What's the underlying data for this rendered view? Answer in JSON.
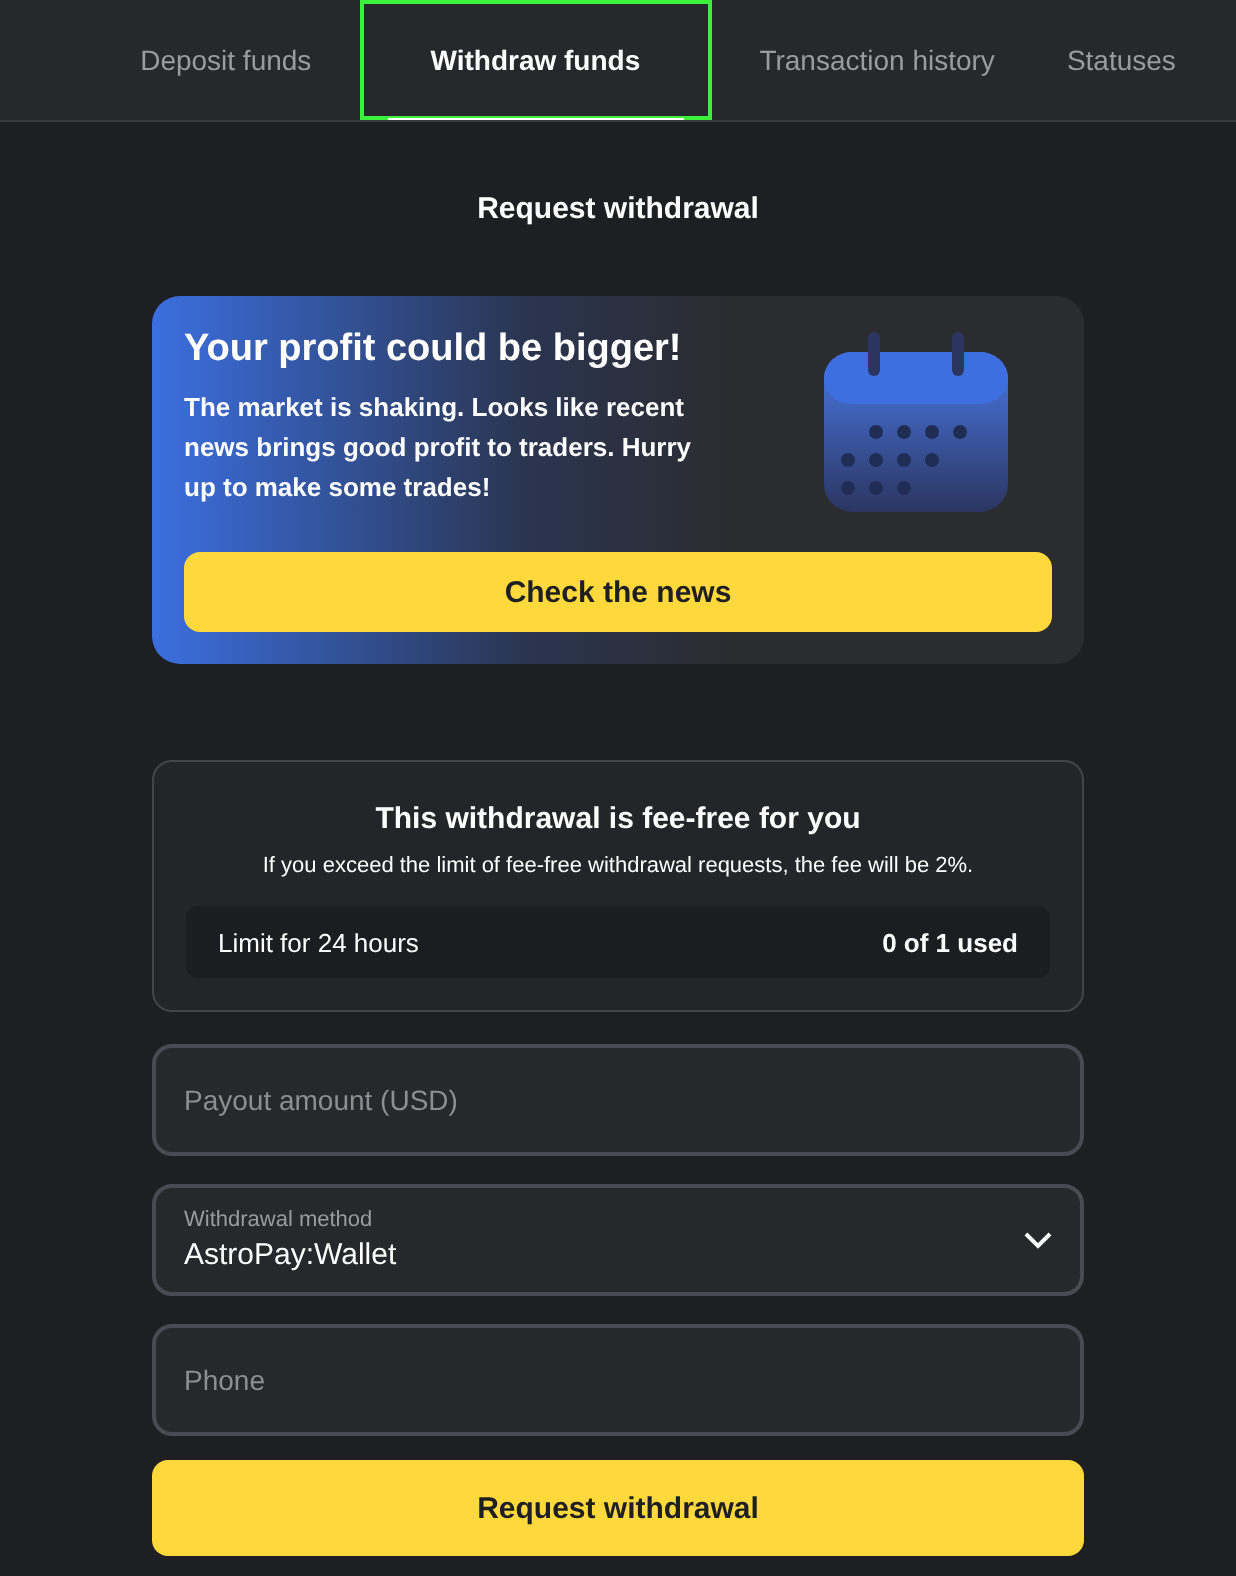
{
  "tabs": [
    {
      "label": "Deposit funds",
      "selected": false,
      "highlighted": false
    },
    {
      "label": "Withdraw funds",
      "selected": true,
      "highlighted": true
    },
    {
      "label": "Transaction history",
      "selected": false,
      "highlighted": false
    },
    {
      "label": "Statuses",
      "selected": false,
      "highlighted": false
    }
  ],
  "heading": "Request withdrawal",
  "promo": {
    "title": "Your profit could be bigger!",
    "text": "The market is shaking. Looks like recent news brings good profit to traders. Hurry up to make some trades!",
    "button": "Check the news"
  },
  "fee": {
    "title": "This withdrawal is fee-free for you",
    "note": "If you exceed the limit of fee-free withdrawal requests, the fee will be 2%.",
    "limit_label": "Limit for 24 hours",
    "limit_value": "0 of 1 used"
  },
  "fields": [
    {
      "kind": "input",
      "placeholder": "Payout amount (USD)"
    },
    {
      "kind": "select",
      "label": "Withdrawal method",
      "value": "AstroPay:Wallet"
    },
    {
      "kind": "input",
      "placeholder": "Phone"
    }
  ],
  "submit": "Request withdrawal"
}
